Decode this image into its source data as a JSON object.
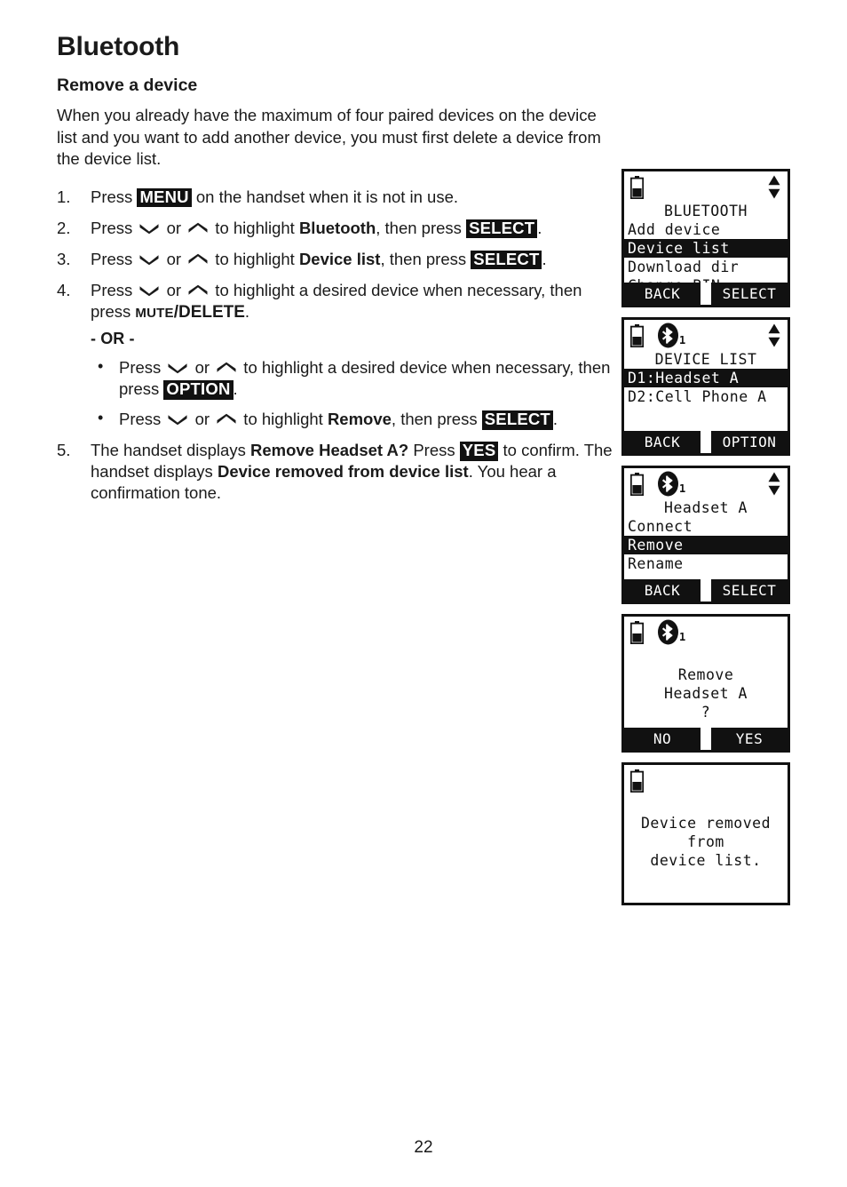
{
  "document": {
    "chapter_title": "Bluetooth",
    "section_title": "Remove a device",
    "intro": "When you already have the maximum of four paired devices on the device list and you want to add another device, you must first delete a device from the device list.",
    "page_number": "22"
  },
  "steps": {
    "s1": {
      "num": "1.",
      "p1": "Press ",
      "key1": "MENU",
      "p2": " on the handset when it is not in use."
    },
    "s2": {
      "num": "2.",
      "p1": "Press ",
      "or": " or ",
      "p2": " to highlight ",
      "target": "Bluetooth",
      "p3": ", then press ",
      "key1": "SELECT",
      "p4": "."
    },
    "s3": {
      "num": "3.",
      "p1": "Press ",
      "or": " or ",
      "p2": " to highlight ",
      "target": "Device list",
      "p3": ", then press ",
      "key1": "SELECT",
      "p4": "."
    },
    "s4": {
      "num": "4.",
      "p1": "Press ",
      "or": " or ",
      "p2": " to highlight a desired device when necessary, then press ",
      "key_small": "MUTE",
      "key_big": "/DELETE",
      "p3": ".",
      "or_divider": "- OR -",
      "b1": {
        "p1": "Press ",
        "or": " or ",
        "p2": " to highlight a desired device when necessary, then press ",
        "key1": "OPTION",
        "p3": "."
      },
      "b2": {
        "p1": "Press ",
        "or": " or ",
        "p2": " to highlight ",
        "target": "Remove",
        "p3": ", then press ",
        "key1": "SELECT",
        "p4": "."
      }
    },
    "s5": {
      "num": "5.",
      "p1": "The handset displays ",
      "b1": "Remove Headset A?",
      "p2": " Press ",
      "key1": "YES",
      "p3": " to confirm. The handset displays ",
      "b2": "Device removed from device list",
      "p4": ". You hear a confirmation tone."
    }
  },
  "lcd_screens": [
    {
      "name": "bluetooth-menu",
      "battery": true,
      "bluetooth": false,
      "bt_count": "",
      "updown": true,
      "title": "BLUETOOTH",
      "rows": [
        {
          "text": "Add device",
          "highlighted": false
        },
        {
          "text": "Device list",
          "highlighted": true
        },
        {
          "text": "Download dir",
          "highlighted": false
        },
        {
          "text": "Change PIN",
          "highlighted": false
        }
      ],
      "softkey_left": "BACK",
      "softkey_right": "SELECT"
    },
    {
      "name": "device-list",
      "battery": true,
      "bluetooth": true,
      "bt_count": "1",
      "updown": true,
      "title": "DEVICE LIST",
      "rows": [
        {
          "text": "D1:Headset A",
          "highlighted": true
        },
        {
          "text": "D2:Cell Phone A",
          "highlighted": false
        }
      ],
      "softkey_left": "BACK",
      "softkey_right": "OPTION"
    },
    {
      "name": "headset-options",
      "battery": true,
      "bluetooth": true,
      "bt_count": "1",
      "updown": true,
      "title": "Headset A",
      "rows": [
        {
          "text": "Connect",
          "highlighted": false
        },
        {
          "text": "Remove",
          "highlighted": true
        },
        {
          "text": "Rename",
          "highlighted": false
        }
      ],
      "softkey_left": "BACK",
      "softkey_right": "SELECT"
    },
    {
      "name": "remove-confirm",
      "battery": true,
      "bluetooth": true,
      "bt_count": "1",
      "updown": false,
      "title": "",
      "rows": [
        {
          "text": "",
          "highlighted": false
        },
        {
          "text": "Remove",
          "highlighted": false,
          "center": true
        },
        {
          "text": "Headset A",
          "highlighted": false,
          "center": true
        },
        {
          "text": "?",
          "highlighted": false,
          "center": true
        }
      ],
      "softkey_left": "NO",
      "softkey_right": "YES"
    },
    {
      "name": "device-removed",
      "battery": true,
      "bluetooth": false,
      "bt_count": "",
      "updown": false,
      "title": "",
      "rows": [
        {
          "text": "",
          "highlighted": false
        },
        {
          "text": "Device removed",
          "highlighted": false,
          "center": true
        },
        {
          "text": "from",
          "highlighted": false,
          "center": true
        },
        {
          "text": "device list.",
          "highlighted": false,
          "center": true
        }
      ],
      "softkey_left": "",
      "softkey_right": ""
    }
  ],
  "colors": {
    "ink": "#111111",
    "paper": "#ffffff"
  }
}
